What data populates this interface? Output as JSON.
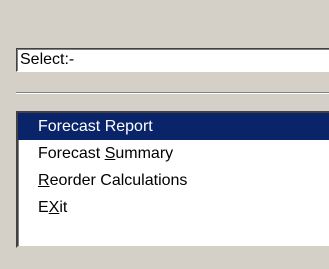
{
  "select_field": {
    "value": "Select:-"
  },
  "menu_list": {
    "items": [
      {
        "pre": "Forecast Report",
        "mn": "",
        "post": "",
        "selected": true
      },
      {
        "pre": "Forecast ",
        "mn": "S",
        "post": "ummary",
        "selected": false
      },
      {
        "pre": "",
        "mn": "R",
        "post": "eorder Calculations",
        "selected": false
      },
      {
        "pre": "E",
        "mn": "X",
        "post": "it",
        "selected": false
      }
    ]
  },
  "colors": {
    "selection_background": "#0a246a",
    "selection_text": "#ffffff",
    "window_background": "#d4d0c8"
  }
}
